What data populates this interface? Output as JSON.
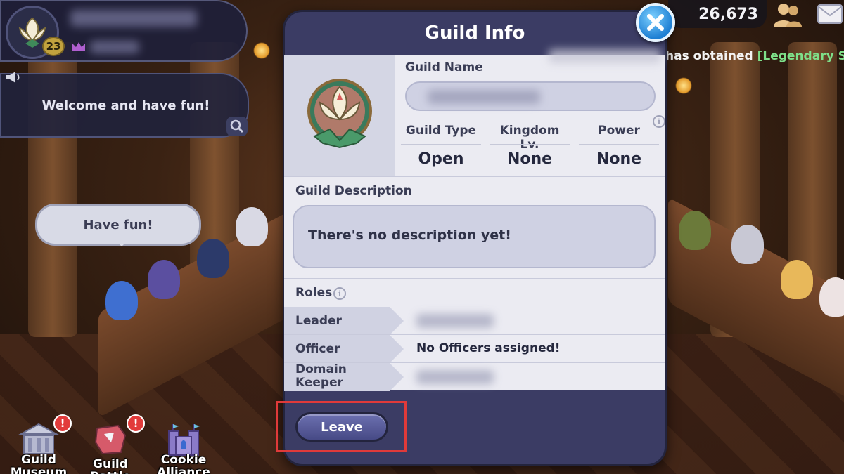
{
  "player": {
    "level": "23"
  },
  "chat": {
    "welcome_message": "Welcome and have fun!",
    "speech_bubble": "Have fun!"
  },
  "currency": {
    "amount": "26,673"
  },
  "ticker": {
    "message": "has obtained",
    "item": "[Legendary Sw"
  },
  "modal": {
    "title": "Guild Info",
    "guild_name_label": "Guild Name",
    "stats": [
      {
        "label": "Guild Type",
        "value": "Open"
      },
      {
        "label": "Kingdom Lv.",
        "value": "None"
      },
      {
        "label": "Power",
        "value": "None"
      }
    ],
    "description_label": "Guild Description",
    "description": "There's no description yet!",
    "roles_label": "Roles",
    "roles": [
      {
        "name": "Leader",
        "value": ""
      },
      {
        "name": "Officer",
        "value": "No Officers assigned!"
      },
      {
        "name_line1": "Domain",
        "name_line2": "Keeper",
        "value": ""
      }
    ],
    "leave_button": "Leave"
  },
  "bottom_menu": [
    {
      "label_line1": "Guild",
      "label_line2": "Museum",
      "alert": "!"
    },
    {
      "label_line1": "Guild Battle",
      "label_line2": "",
      "alert": "!"
    },
    {
      "label_line1": "Cookie",
      "label_line2": "Alliance",
      "alert": ""
    }
  ],
  "colors": {
    "modal": "#3b3c64",
    "panel": "#ebebf2",
    "highlight": "#e03a3a",
    "close": "#1e7fd3",
    "ticker_item": "#7ee08a"
  }
}
